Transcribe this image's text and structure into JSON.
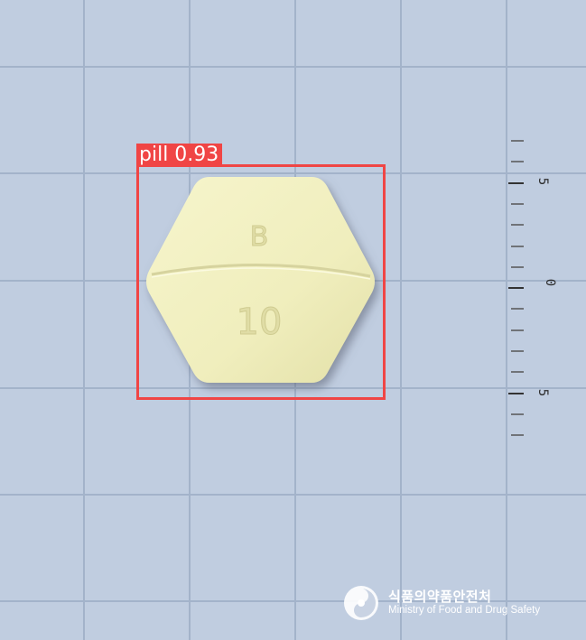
{
  "detection": {
    "label": "pill 0.93",
    "class_name": "pill",
    "confidence": 0.93,
    "box_color": "#f04545"
  },
  "pill": {
    "imprint_top": "B",
    "imprint_bottom": "10",
    "color": "#f3f1c0",
    "shape": "hexagon"
  },
  "ruler": {
    "labels": [
      "5",
      "0",
      "5"
    ]
  },
  "watermark": {
    "korean_text": "식품의약품안전처",
    "english_text": "Ministry of Food and Drug Safety",
    "logo_icon": "mfds-taegeuk-logo-icon"
  },
  "background": {
    "color": "#c0cde0",
    "grid_color": "#9fb0c8"
  }
}
